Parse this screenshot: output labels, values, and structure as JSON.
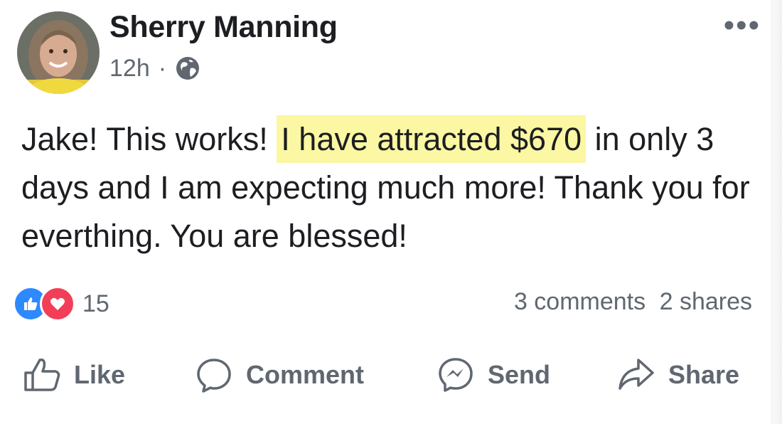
{
  "post": {
    "author": "Sherry Manning",
    "timestamp": "12h",
    "separator": "·",
    "privacy_icon": "globe-icon",
    "more_menu": "•••",
    "text_before": "Jake! This works!",
    "text_highlight": "I have attracted $670",
    "text_after": "in only 3 days and I am expecting much more! Thank you for everthing. You are blessed!",
    "highlight_color": "#fbf7a3"
  },
  "engagement": {
    "reaction_count": "15",
    "reactions": [
      "like-reaction-icon",
      "love-reaction-icon"
    ],
    "comments": "3 comments",
    "shares": "2 shares"
  },
  "actions": {
    "like": "Like",
    "comment": "Comment",
    "send": "Send",
    "share": "Share"
  },
  "colors": {
    "like_blue": "#2e89ff",
    "love_red": "#f33e58",
    "secondary_text": "#606770"
  }
}
